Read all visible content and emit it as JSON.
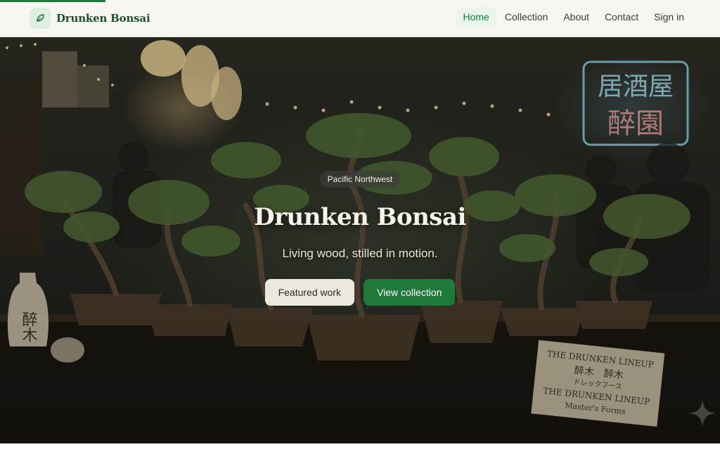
{
  "header": {
    "brand": {
      "name": "Drunken Bonsai",
      "icon": "leaf-icon"
    },
    "nav": [
      {
        "label": "Home",
        "active": true
      },
      {
        "label": "Collection",
        "active": false
      },
      {
        "label": "About",
        "active": false
      },
      {
        "label": "Contact",
        "active": false
      },
      {
        "label": "Sign in",
        "active": false
      }
    ]
  },
  "hero": {
    "badge": "Pacific Northwest",
    "title": "Drunken Bonsai",
    "subtitle": "Living wood, stilled in motion.",
    "actions": {
      "primary": "Featured work",
      "secondary": "View collection"
    },
    "signs": {
      "neon_top": "居酒屋",
      "neon_bottom": "醉園",
      "bottle": "醉木",
      "card_line1": "THE DRUNKEN LINEUP",
      "card_line2": "醉木　醉木",
      "card_line3": "ドレックフース",
      "card_line4": "THE DRUNKEN LINEUP",
      "card_line5": "Master's Forms"
    }
  },
  "colors": {
    "accent": "#1f7a3a",
    "header_bg": "#f8f6f1",
    "hero_dark": "#1e1f1a"
  }
}
